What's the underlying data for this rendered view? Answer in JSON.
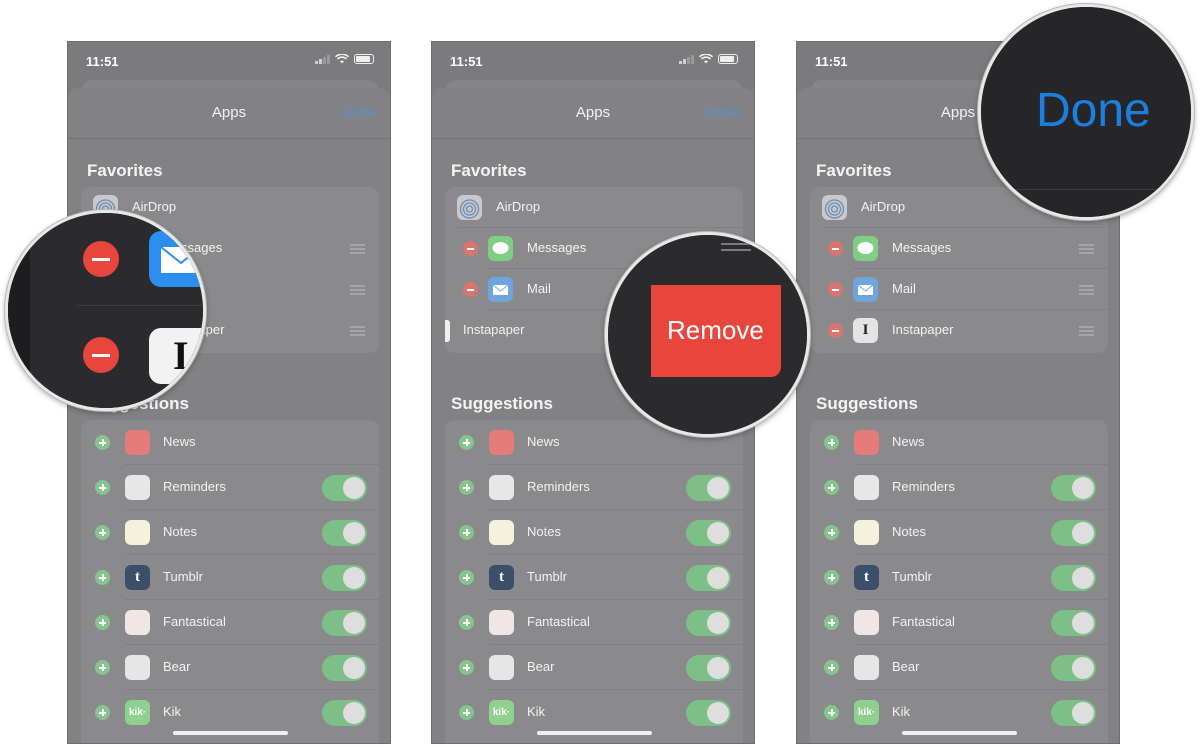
{
  "panels": [
    {
      "status": {
        "time": "11:51"
      },
      "nav": {
        "title": "Apps",
        "done": "Done"
      },
      "favorites_title": "Favorites",
      "favorites": [
        {
          "name": "AirDrop",
          "icon": "airdrop-icon"
        },
        {
          "name": "Messages",
          "icon": "messages-icon"
        },
        {
          "name": "Mail",
          "icon": "mail-icon"
        },
        {
          "name": "Instapaper",
          "icon": "instapaper-icon"
        }
      ],
      "suggestions_title": "Suggestions",
      "suggestions": [
        {
          "name": "News",
          "icon": "news-icon",
          "toggle": false
        },
        {
          "name": "Reminders",
          "icon": "reminders-icon",
          "toggle": true
        },
        {
          "name": "Notes",
          "icon": "notes-icon",
          "toggle": true
        },
        {
          "name": "Tumblr",
          "icon": "tumblr-icon",
          "toggle": true
        },
        {
          "name": "Fantastical",
          "icon": "fantastical-icon",
          "toggle": true
        },
        {
          "name": "Bear",
          "icon": "bear-icon",
          "toggle": true
        },
        {
          "name": "Kik",
          "icon": "kik-icon",
          "toggle": true
        }
      ]
    }
  ],
  "callouts": {
    "remove_label": "Remove",
    "done_label": "Done",
    "instapaper_icon_letter": "I"
  },
  "icons": {
    "tumblr_letter": "t",
    "instapaper_letter": "I",
    "kik_text": "kik·"
  },
  "colors": {
    "remove_red": "#e8453c",
    "done_blue": "#1a7fe0",
    "toggle_green": "#7cc087",
    "minus_red": "#d9746f",
    "plus_green": "#86c48d"
  }
}
